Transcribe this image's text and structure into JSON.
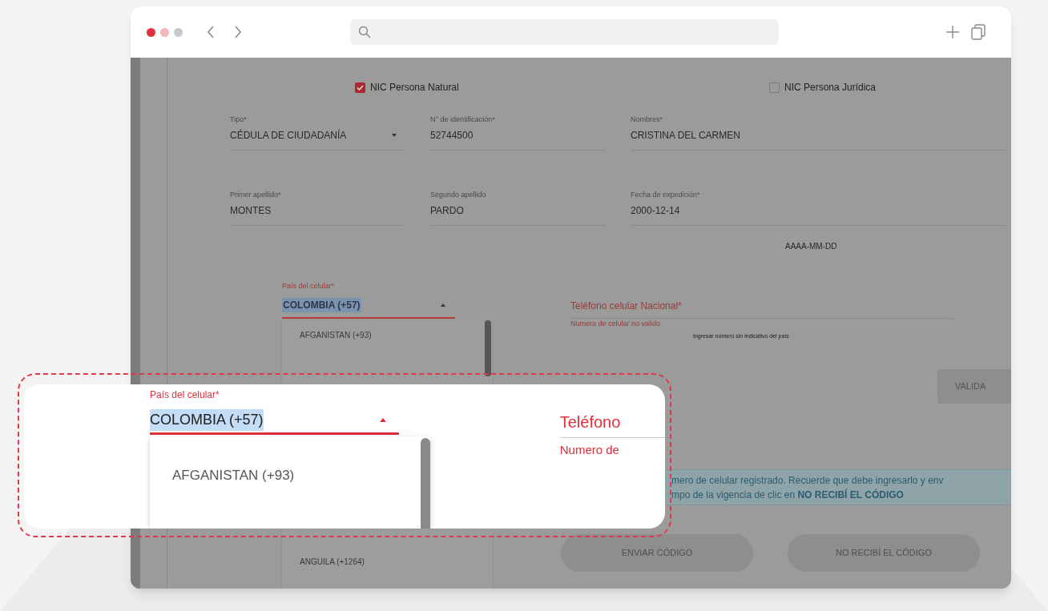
{
  "form": {
    "checkboxes": [
      {
        "label": "NIC Persona Natural",
        "checked": true
      },
      {
        "label": "NIC Persona Jurídica",
        "checked": false
      }
    ],
    "fields": [
      {
        "label": "Tipo*",
        "value": "CÉDULA DE CIUDADANÍA",
        "kind": "select"
      },
      {
        "label": "N° de identificación*",
        "value": "52744500",
        "kind": "text"
      },
      {
        "label": "Nombres*",
        "value": "CRISTINA DEL CARMEN",
        "kind": "text"
      },
      {
        "label": "Primer apellido*",
        "value": "MONTES",
        "kind": "text"
      },
      {
        "label": "Segundo apellido",
        "value": "PARDO",
        "kind": "text"
      },
      {
        "label": "Fecha de expedición*",
        "value": "2000-12-14",
        "kind": "text"
      }
    ],
    "date_hint": "AAAA-MM-DD",
    "country": {
      "label": "País del celular*",
      "value": "COLOMBIA (+57)",
      "options": [
        "AFGANISTAN (+93)",
        "ANGUILA (+1264)"
      ]
    },
    "phone": {
      "label": "Teléfono celular Nacional*",
      "error": "Numero de celular no valido",
      "hint": "Ingresar número sin indicativo del país"
    },
    "validate_button": "VALIDA",
    "info": [
      "mero de celular registrado. Recuerde que debe ingresarlo y env",
      "mpo de la vigencia de clic en **NO RECIBÍ EL CÓDIGO**"
    ],
    "buttons": [
      {
        "label": "ENVIAR CÓDIGO",
        "disabled": true
      },
      {
        "label": "NO RECIBÍ EL CÓDIGO",
        "disabled": true
      }
    ]
  },
  "callout": {
    "country_label": "País del celular*",
    "country_value": "COLOMBIA (+57)",
    "option": "AFGANISTAN (+93)",
    "phone_label": "Teléfono",
    "phone_error": "Numero de"
  }
}
